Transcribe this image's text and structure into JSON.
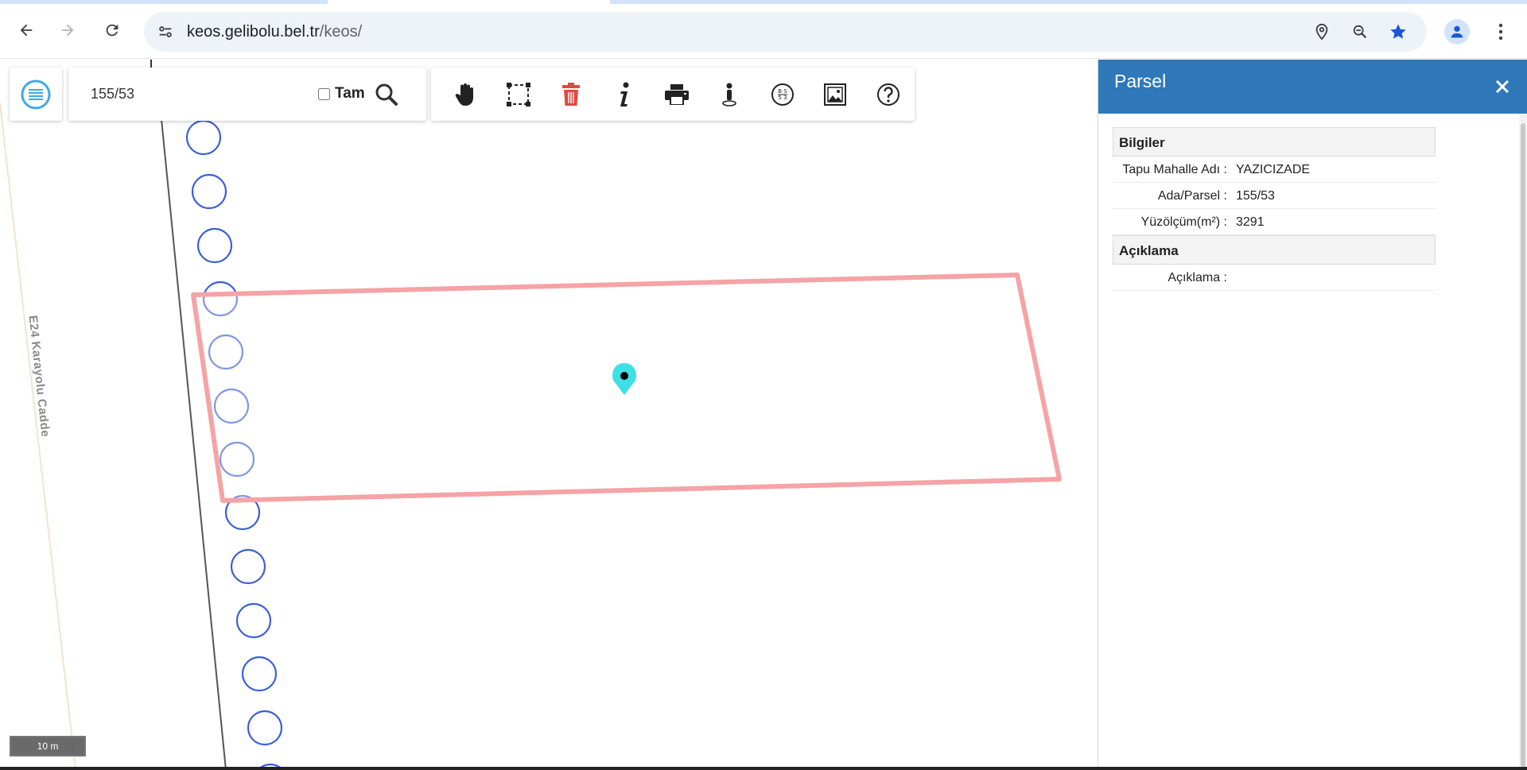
{
  "browser": {
    "url_host": "keos.gelibolu.bel.tr",
    "url_path": "/keos/"
  },
  "map": {
    "road_label": "E24 Karayolu Cadde",
    "scale_label": "10 m",
    "search": {
      "value": "155/53"
    },
    "tam_label": "Tam",
    "tam_checked": false,
    "tools": [
      "pan-hand-icon",
      "box-select-icon",
      "trash-icon",
      "info-icon",
      "print-icon",
      "street-view-icon",
      "measure-icon",
      "image-export-icon",
      "help-icon"
    ],
    "colors": {
      "parcel_outline": "#f5a3a6",
      "marker": "#3ee0e6",
      "circles": "#3a5fd6",
      "delete_tool": "#e04a3f"
    }
  },
  "panel": {
    "title": "Parsel",
    "sections": [
      {
        "title": "Bilgiler",
        "rows": [
          {
            "label": "Tapu Mahalle Adı :",
            "value": "YAZICIZADE"
          },
          {
            "label": "Ada/Parsel :",
            "value": "155/53"
          },
          {
            "label": "Yüzölçüm(m²) :",
            "value": "3291"
          }
        ]
      },
      {
        "title": "Açıklama",
        "rows": [
          {
            "label": "Açıklama :",
            "value": ""
          }
        ]
      }
    ],
    "header_color": "#2f78b9"
  }
}
